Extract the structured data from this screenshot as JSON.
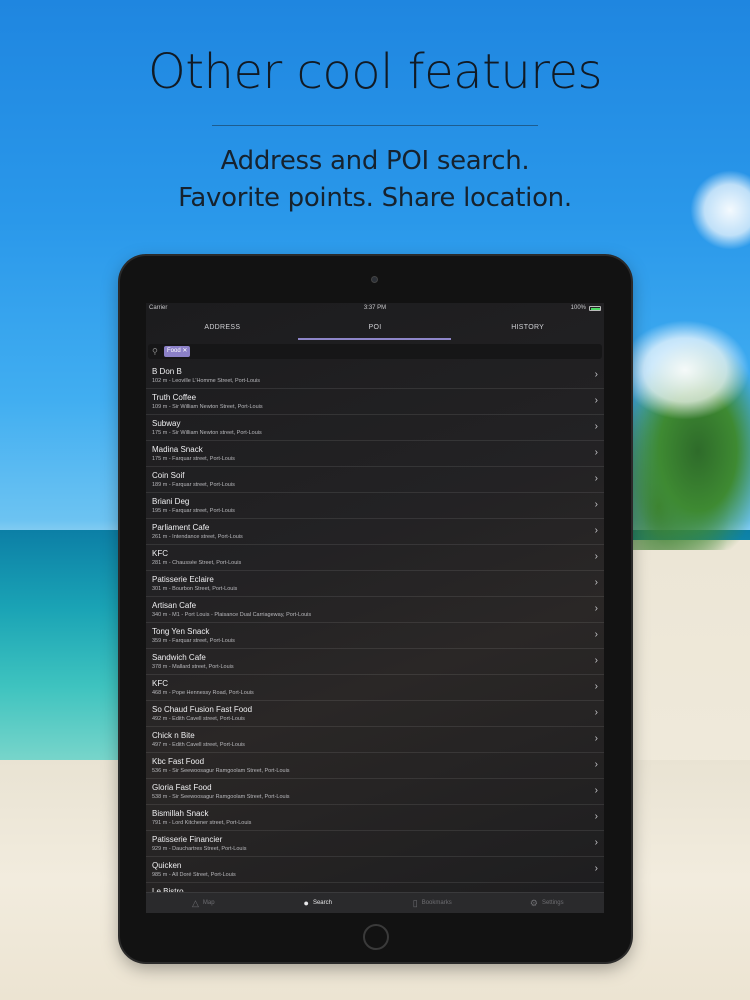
{
  "headline": "Other cool features",
  "subline1": "Address and POI search.",
  "subline2": "Favorite points. Share location.",
  "status": {
    "carrier": "Carrier",
    "time": "3:37 PM",
    "battery": "100%"
  },
  "tabs": [
    "ADDRESS",
    "POI",
    "HISTORY"
  ],
  "search": {
    "chip": "Food ✕"
  },
  "items": [
    {
      "name": "B Don B",
      "addr": "102 m - Leoville L'Homme Street, Port-Louis"
    },
    {
      "name": "Truth Coffee",
      "addr": "109 m - Sir William Newton Street, Port-Louis"
    },
    {
      "name": "Subway",
      "addr": "175 m - Sir William Newton street, Port-Louis"
    },
    {
      "name": "Madina Snack",
      "addr": "175 m - Farquar street, Port-Louis"
    },
    {
      "name": "Coin Soif",
      "addr": "189 m - Farquar street, Port-Louis"
    },
    {
      "name": "Briani Deg",
      "addr": "195 m - Farquar street, Port-Louis"
    },
    {
      "name": "Parliament Cafe",
      "addr": "261 m - Intendance street, Port-Louis"
    },
    {
      "name": "KFC",
      "addr": "281 m - Chaussée Street, Port-Louis"
    },
    {
      "name": "Patisserie Eclaire",
      "addr": "301 m - Bourbon Street, Port-Louis"
    },
    {
      "name": "Artisan Cafe",
      "addr": "340 m - M1 - Port Louis - Plaisance Dual Carriageway, Port-Louis"
    },
    {
      "name": "Tong Yen Snack",
      "addr": "359 m - Farquar street, Port-Louis"
    },
    {
      "name": "Sandwich Cafe",
      "addr": "378 m - Mallard street, Port-Louis"
    },
    {
      "name": "KFC",
      "addr": "468 m - Pope Hennessy Road, Port-Louis"
    },
    {
      "name": "So Chaud Fusion Fast Food",
      "addr": "492 m - Edith Cavell street, Port-Louis"
    },
    {
      "name": "Chick n Bite",
      "addr": "497 m - Edith Cavell street, Port-Louis"
    },
    {
      "name": "Kbc Fast Food",
      "addr": "536 m - Sir Seewoosagur Ramgoolam Street, Port-Louis"
    },
    {
      "name": "Gloria Fast Food",
      "addr": "538 m - Sir Seewoosagur Ramgoolam Street, Port-Louis"
    },
    {
      "name": "Bismillah Snack",
      "addr": "791 m - Lord Kitchener street, Port-Louis"
    },
    {
      "name": "Patisserie Financier",
      "addr": "929 m - Dauchartres Street, Port-Louis"
    },
    {
      "name": "Quicken",
      "addr": "985 m - All Doré Street, Port-Louis"
    },
    {
      "name": "Le Bistro",
      "addr": ""
    }
  ],
  "tabbar": [
    {
      "label": "Map",
      "icon": "map-icon"
    },
    {
      "label": "Search",
      "icon": "search-icon"
    },
    {
      "label": "Bookmarks",
      "icon": "bookmark-icon"
    },
    {
      "label": "Settings",
      "icon": "gear-icon"
    }
  ]
}
